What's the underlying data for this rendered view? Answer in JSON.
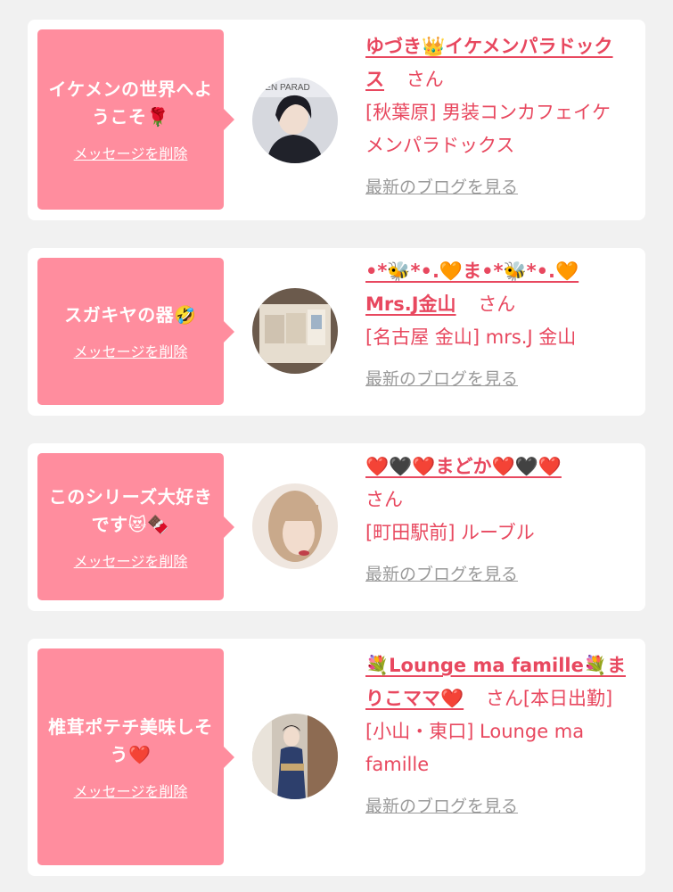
{
  "colors": {
    "bubble": "#ff8d9e",
    "accent": "#e8485f",
    "muted": "#9a9a9a",
    "background": "#f1f1f1"
  },
  "delete_label": "メッセージを削除",
  "blog_label": "最新のブログを見る",
  "san_label": "さん",
  "items": [
    {
      "message": "イケメンの世界へようこそ🌹",
      "name": "ゆづき👑イケメンパラドックス",
      "shop": "[秋葉原] 男装コンカフェイケメンパラドックス",
      "avatar_icon": "avatar-photo-male-host"
    },
    {
      "message": "スガキヤの器🤣",
      "name": "•*🐝*•.🧡ま•*🐝*•.🧡Mrs.J金山",
      "shop": "[名古屋 金山] mrs.J 金山",
      "avatar_icon": "avatar-photo-bowls"
    },
    {
      "message": "このシリーズ大好きです😻🍫",
      "name": "❤️🖤❤️まどか❤️🖤❤️",
      "shop": "[町田駅前] ルーブル",
      "avatar_icon": "avatar-photo-girl"
    },
    {
      "message": "椎茸ポテチ美味しそう❤️",
      "name": "💐Lounge ma famille💐まりこママ❤️",
      "san_suffix": "[本日出勤]",
      "shop": "[小山・東口] Lounge ma famille",
      "avatar_icon": "avatar-photo-kimono"
    }
  ]
}
